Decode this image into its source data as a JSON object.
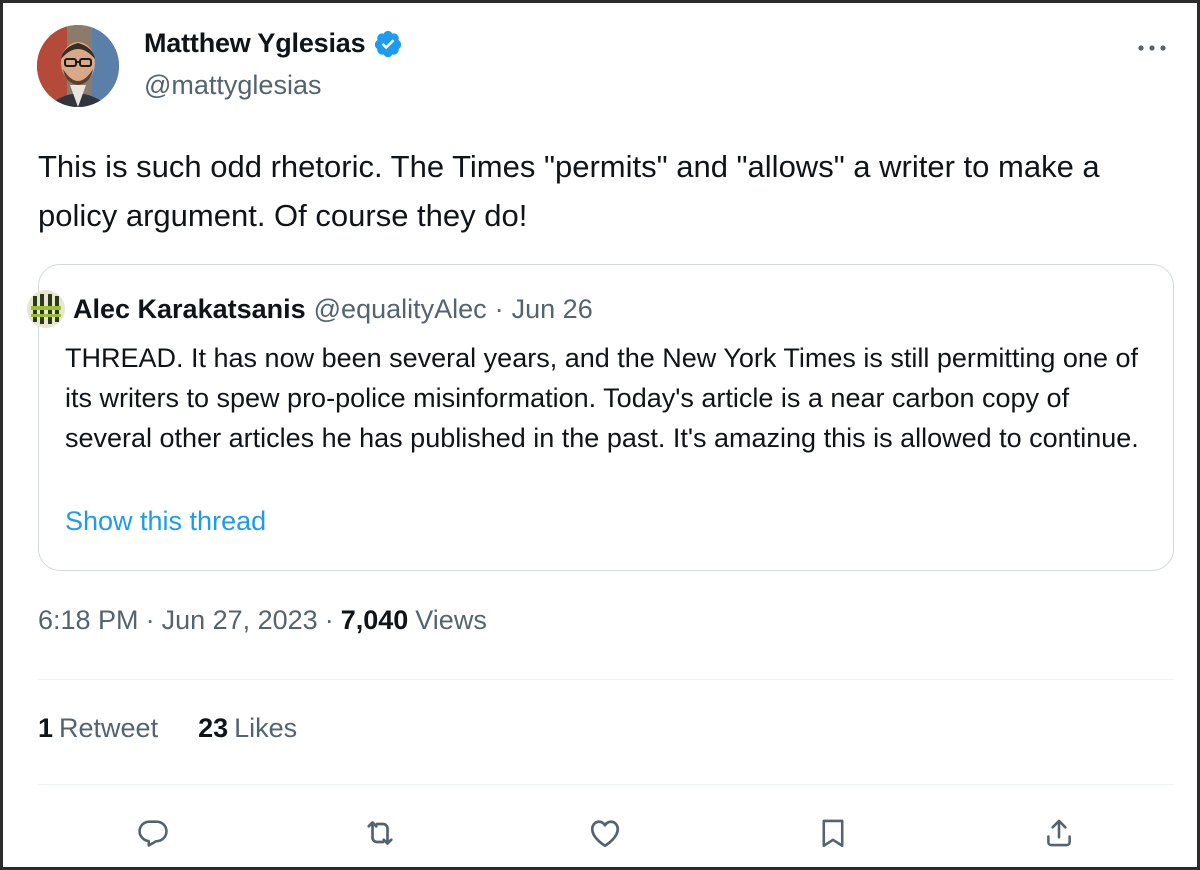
{
  "author": {
    "display_name": "Matthew Yglesias",
    "handle": "@mattyglesias",
    "verified_icon": "verified-badge-icon",
    "brand_color": "#1d9bf0"
  },
  "menu": {
    "more_icon": "more-options-icon"
  },
  "tweet": {
    "text": "This is such odd rhetoric. The Times \"permits\" and \"allows\" a writer to make a policy argument. Of course they do!"
  },
  "quoted": {
    "display_name": "Alec Karakatsanis",
    "handle": "@equalityAlec",
    "separator": "·",
    "date": "Jun 26",
    "text": "THREAD.  It has now been several years, and the New York Times is still permitting one of its writers to spew pro-police misinformation. Today's article is a near carbon copy of several other articles he has published in the past. It's amazing this is allowed to continue.",
    "show_thread": "Show this thread"
  },
  "meta": {
    "time": "6:18 PM",
    "sep1": "·",
    "date": "Jun 27, 2023",
    "sep2": "·",
    "views_count": "7,040",
    "views_label": "Views"
  },
  "stats": {
    "retweets_count": "1",
    "retweets_label": "Retweet",
    "likes_count": "23",
    "likes_label": "Likes"
  },
  "actions": [
    {
      "icon": "reply-icon"
    },
    {
      "icon": "retweet-icon"
    },
    {
      "icon": "like-icon"
    },
    {
      "icon": "bookmark-icon"
    },
    {
      "icon": "share-icon"
    }
  ],
  "colors": {
    "text": "#0f1419",
    "secondary": "#536471",
    "link": "#1d9bf0",
    "border": "#cfd9de"
  }
}
